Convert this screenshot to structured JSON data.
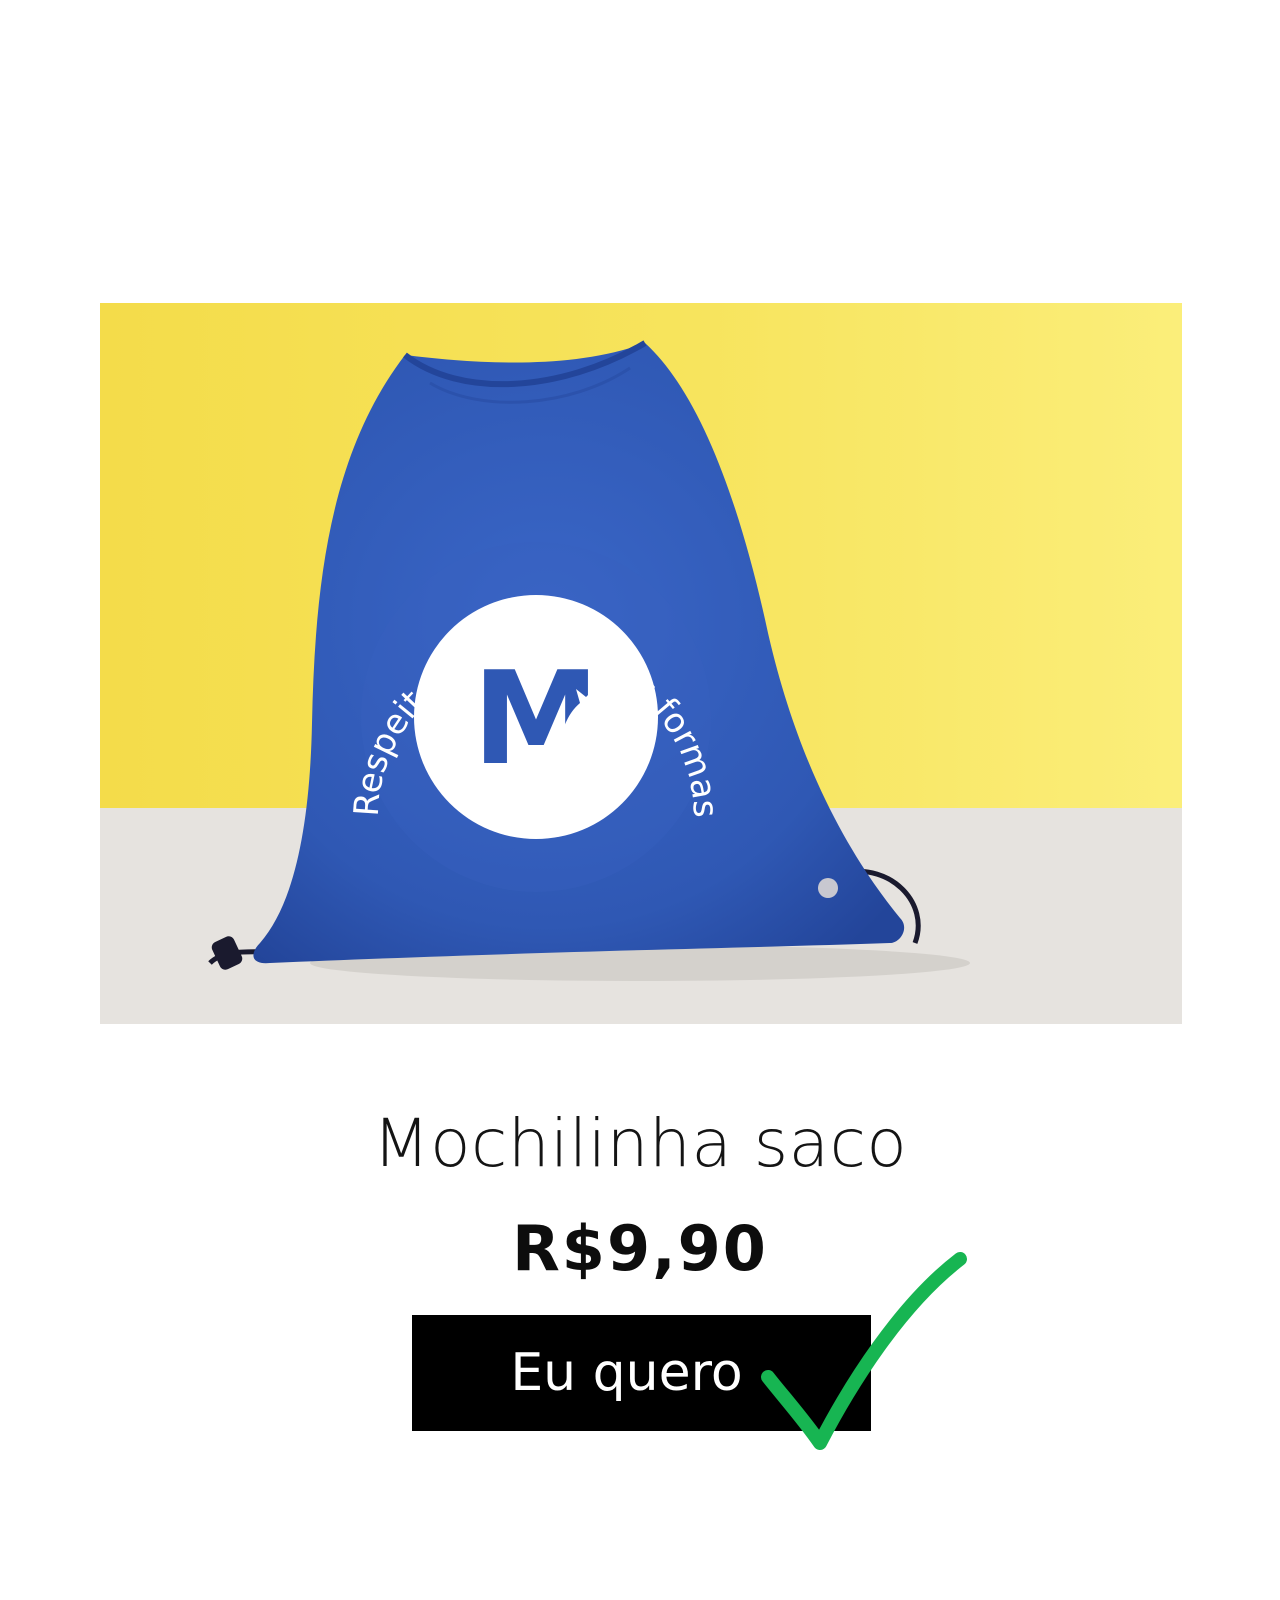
{
  "product": {
    "image_alt": "Mochila saco azul com logotipo",
    "bag_slogan": "Respeito por todas as formas de vida.",
    "logo_letter": "M",
    "title": "Mochilinha saco",
    "price": "R$9,90"
  },
  "cta": {
    "label": "Eu quero",
    "icon": "check-icon"
  },
  "colors": {
    "bag_blue": "#2f58b4",
    "background_yellow": "#f6e158",
    "button_black": "#000000",
    "check_green": "#17b552"
  }
}
